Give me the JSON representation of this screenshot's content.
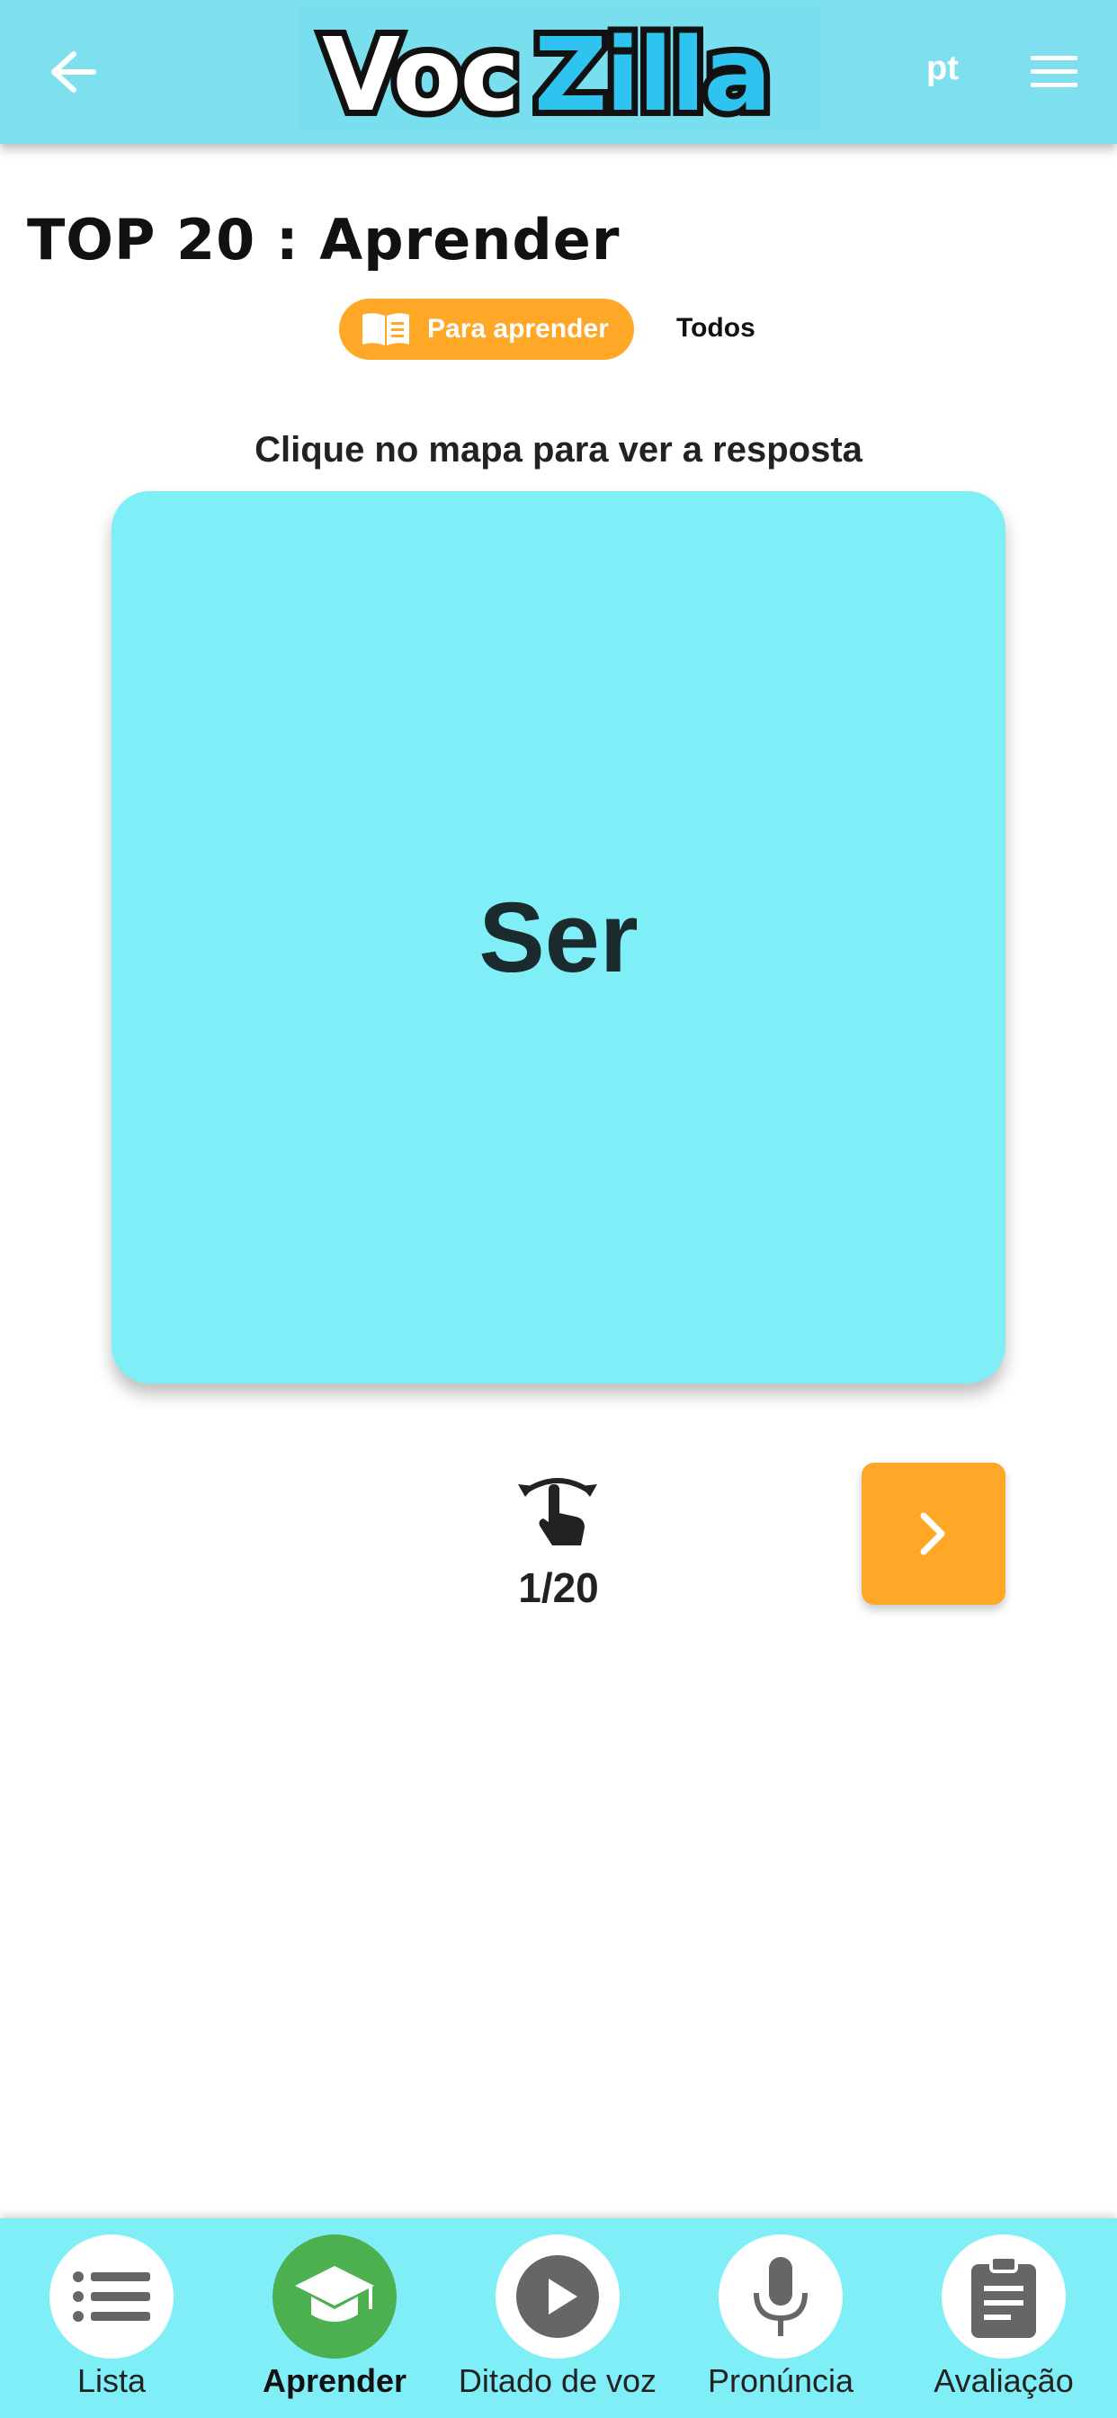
{
  "header": {
    "logo_part1": "Voc",
    "logo_part2": "Zilla",
    "language": "pt",
    "back_icon": "arrow-left-icon",
    "menu_icon": "hamburger-icon"
  },
  "page": {
    "title": "TOP 20 : Aprender"
  },
  "tabs": [
    {
      "label": "Para aprender",
      "icon": "book-icon",
      "active": true
    },
    {
      "label": "Todos",
      "active": false
    }
  ],
  "instruction": "Clique no mapa para ver a resposta",
  "card": {
    "word": "Ser"
  },
  "progress": {
    "counter": "1/20",
    "icon": "tap-flip-icon"
  },
  "bottom_nav": [
    {
      "label": "Lista",
      "icon": "list-icon",
      "active": false
    },
    {
      "label": "Aprender",
      "icon": "graduation-cap-icon",
      "active": true
    },
    {
      "label": "Ditado de voz",
      "icon": "play-icon",
      "active": false
    },
    {
      "label": "Pronúncia",
      "icon": "microphone-icon",
      "active": false
    },
    {
      "label": "Avaliação",
      "icon": "clipboard-icon",
      "active": false
    }
  ],
  "colors": {
    "header": "#7ee0ee",
    "accent": "#ffa726",
    "card": "#80eef6",
    "active_nav": "#4caf50"
  }
}
